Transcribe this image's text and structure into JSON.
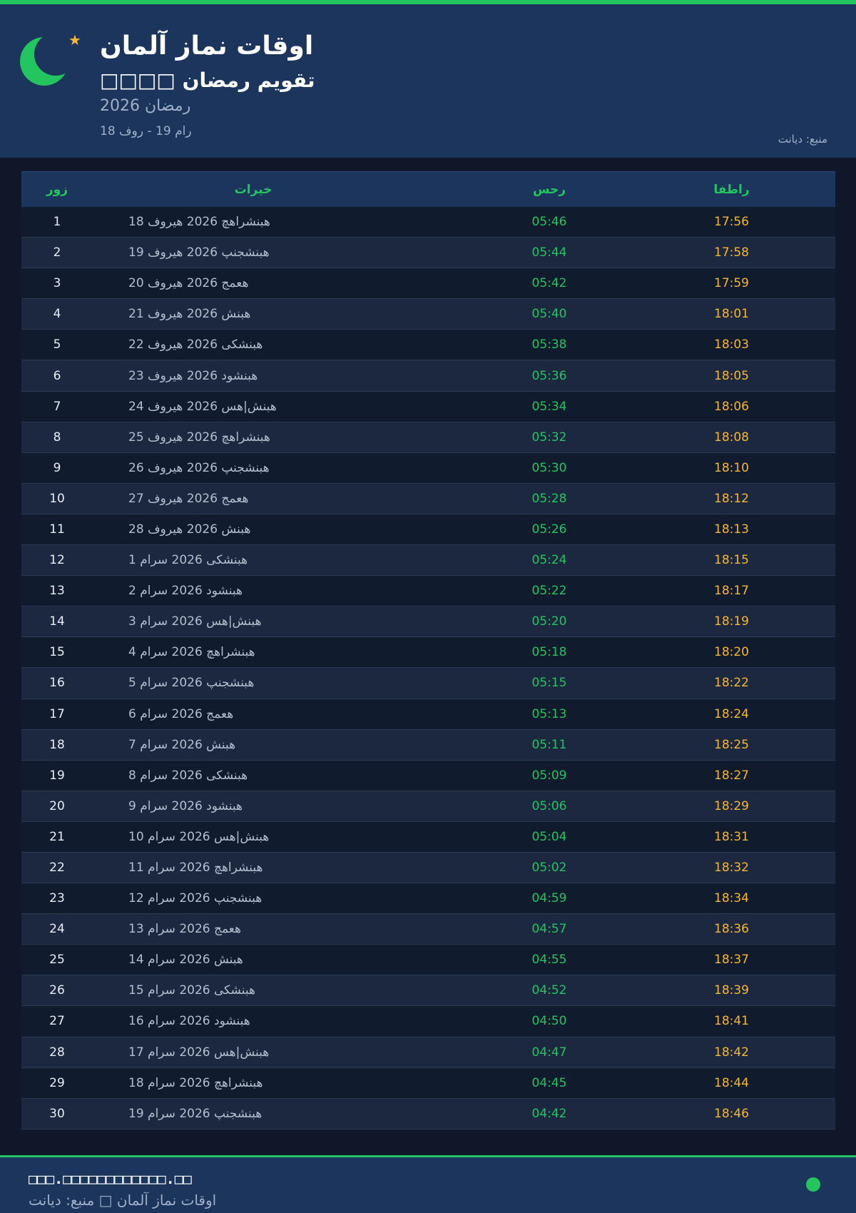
{
  "header": {
    "title": "اوقات نماز آلمان",
    "subtitle": "□□□□ تقویم رمضان",
    "year": "رمضان 2026",
    "range": "رام 19 - روف 18",
    "source": "منبع: دیانت"
  },
  "table": {
    "headers": {
      "day": "زور",
      "date": "خیرات",
      "sahar": "رحس",
      "iftar": "راطفا"
    },
    "rows": [
      {
        "day": "1",
        "date": "هبنشراهچ 2026 هیروف 18",
        "sahar": "05:46",
        "iftar": "17:56"
      },
      {
        "day": "2",
        "date": "هبنشجنپ 2026 هیروف 19",
        "sahar": "05:44",
        "iftar": "17:58"
      },
      {
        "day": "3",
        "date": "هعمج 2026 هیروف 20",
        "sahar": "05:42",
        "iftar": "17:59"
      },
      {
        "day": "4",
        "date": "هبنش 2026 هیروف 21",
        "sahar": "05:40",
        "iftar": "18:01"
      },
      {
        "day": "5",
        "date": "هبنشکی 2026 هیروف 22",
        "sahar": "05:38",
        "iftar": "18:03"
      },
      {
        "day": "6",
        "date": "هبنشود 2026 هیروف 23",
        "sahar": "05:36",
        "iftar": "18:05"
      },
      {
        "day": "7",
        "date": "هبنش|هس 2026 هیروف 24",
        "sahar": "05:34",
        "iftar": "18:06"
      },
      {
        "day": "8",
        "date": "هبنشراهچ 2026 هیروف 25",
        "sahar": "05:32",
        "iftar": "18:08"
      },
      {
        "day": "9",
        "date": "هبنشجنپ 2026 هیروف 26",
        "sahar": "05:30",
        "iftar": "18:10"
      },
      {
        "day": "10",
        "date": "هعمج 2026 هیروف 27",
        "sahar": "05:28",
        "iftar": "18:12"
      },
      {
        "day": "11",
        "date": "هبنش 2026 هیروف 28",
        "sahar": "05:26",
        "iftar": "18:13"
      },
      {
        "day": "12",
        "date": "هبنشکی 2026 سرام 1",
        "sahar": "05:24",
        "iftar": "18:15"
      },
      {
        "day": "13",
        "date": "هبنشود 2026 سرام 2",
        "sahar": "05:22",
        "iftar": "18:17"
      },
      {
        "day": "14",
        "date": "هبنش|هس 2026 سرام 3",
        "sahar": "05:20",
        "iftar": "18:19"
      },
      {
        "day": "15",
        "date": "هبنشراهچ 2026 سرام 4",
        "sahar": "05:18",
        "iftar": "18:20"
      },
      {
        "day": "16",
        "date": "هبنشجنپ 2026 سرام 5",
        "sahar": "05:15",
        "iftar": "18:22"
      },
      {
        "day": "17",
        "date": "هعمج 2026 سرام 6",
        "sahar": "05:13",
        "iftar": "18:24"
      },
      {
        "day": "18",
        "date": "هبنش 2026 سرام 7",
        "sahar": "05:11",
        "iftar": "18:25"
      },
      {
        "day": "19",
        "date": "هبنشکی 2026 سرام 8",
        "sahar": "05:09",
        "iftar": "18:27"
      },
      {
        "day": "20",
        "date": "هبنشود 2026 سرام 9",
        "sahar": "05:06",
        "iftar": "18:29"
      },
      {
        "day": "21",
        "date": "هبنش|هس 2026 سرام 10",
        "sahar": "05:04",
        "iftar": "18:31"
      },
      {
        "day": "22",
        "date": "هبنشراهچ 2026 سرام 11",
        "sahar": "05:02",
        "iftar": "18:32"
      },
      {
        "day": "23",
        "date": "هبنشجنپ 2026 سرام 12",
        "sahar": "04:59",
        "iftar": "18:34"
      },
      {
        "day": "24",
        "date": "هعمج 2026 سرام 13",
        "sahar": "04:57",
        "iftar": "18:36"
      },
      {
        "day": "25",
        "date": "هبنش 2026 سرام 14",
        "sahar": "04:55",
        "iftar": "18:37"
      },
      {
        "day": "26",
        "date": "هبنشکی 2026 سرام 15",
        "sahar": "04:52",
        "iftar": "18:39"
      },
      {
        "day": "27",
        "date": "هبنشود 2026 سرام 16",
        "sahar": "04:50",
        "iftar": "18:41"
      },
      {
        "day": "28",
        "date": "هبنش|هس 2026 سرام 17",
        "sahar": "04:47",
        "iftar": "18:42"
      },
      {
        "day": "29",
        "date": "هبنشراهچ 2026 سرام 18",
        "sahar": "04:45",
        "iftar": "18:44"
      },
      {
        "day": "30",
        "date": "هبنشجنپ 2026 سرام 19",
        "sahar": "04:42",
        "iftar": "18:46"
      }
    ]
  },
  "footer": {
    "site": "□□□.□□□□□□□□□□□□.□□",
    "note": "اوقات نماز آلمان □ منبع: دیانت"
  },
  "icons": {
    "moon": "crescent-moon-icon",
    "star": "star-icon",
    "status_dot": "status-dot"
  },
  "colors": {
    "accent_green": "#22c55e",
    "accent_gold": "#f5b82e",
    "header_bg": "#1c355c",
    "page_bg": "#0f1729"
  }
}
